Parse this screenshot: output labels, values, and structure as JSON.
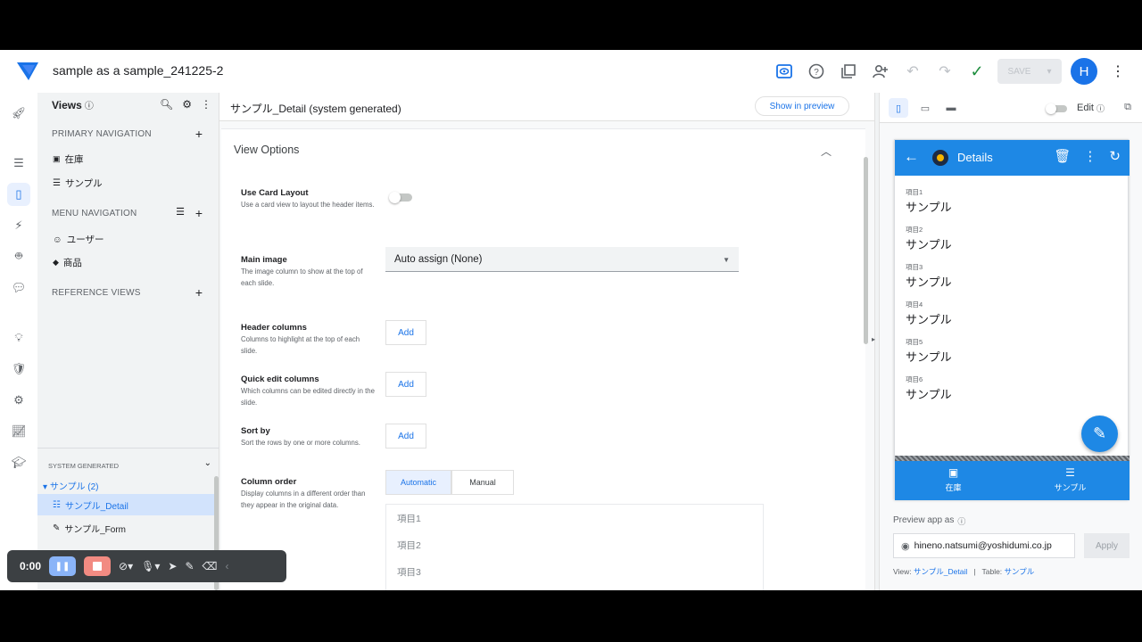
{
  "app": {
    "title": "sample as a sample_241225-2",
    "avatar_initial": "H",
    "save_label": "SAVE"
  },
  "views_panel": {
    "title": "Views",
    "primary_nav_label": "PRIMARY NAVIGATION",
    "primary_items": [
      "在庫",
      "サンプル"
    ],
    "menu_nav_label": "MENU NAVIGATION",
    "menu_items": [
      "ユーザー",
      "商品"
    ],
    "reference_label": "REFERENCE VIEWS",
    "system_label": "SYSTEM GENERATED",
    "system_group": "サンプル (2)",
    "system_items": [
      "サンプル_Detail",
      "サンプル_Form"
    ]
  },
  "editor": {
    "title": "サンプル_Detail (system generated)",
    "preview_button": "Show in preview",
    "section_title": "View Options",
    "options": [
      {
        "label": "Use Card Layout",
        "desc": "Use a card view to layout the header items."
      },
      {
        "label": "Main image",
        "desc": "The image column to show at the top of each slide."
      },
      {
        "label": "Header columns",
        "desc": "Columns to highlight at the top of each slide."
      },
      {
        "label": "Quick edit columns",
        "desc": "Which columns can be edited directly in the slide."
      },
      {
        "label": "Sort by",
        "desc": "Sort the rows by one or more columns."
      },
      {
        "label": "Column order",
        "desc": "Display columns in a different order than they appear in the original data."
      }
    ],
    "card_layout_enabled": false,
    "main_image_value": "Auto assign (None)",
    "add_label": "Add",
    "order_modes": [
      "Automatic",
      "Manual"
    ],
    "order_items": [
      "項目1",
      "項目2",
      "項目3"
    ]
  },
  "preview": {
    "edit_label": "Edit",
    "app_bar_title": "Details",
    "fields": [
      {
        "label": "項目1",
        "value": "サンプル"
      },
      {
        "label": "項目2",
        "value": "サンプル"
      },
      {
        "label": "項目3",
        "value": "サンプル"
      },
      {
        "label": "項目4",
        "value": "サンプル"
      },
      {
        "label": "項目5",
        "value": "サンプル"
      },
      {
        "label": "項目6",
        "value": "サンプル"
      }
    ],
    "nav": [
      "在庫",
      "サンプル"
    ],
    "preview_as_label": "Preview app as",
    "preview_as_value": "hineno.natsumi@yoshidumi.co.jp",
    "apply_label": "Apply",
    "footer": {
      "view_label": "View:",
      "view_value": "サンプル_Detail",
      "sep": "|",
      "table_label": "Table:",
      "table_value": "サンプル"
    }
  },
  "recorder": {
    "time": "0:00"
  },
  "colors": {
    "accent": "#1a73e8",
    "phone_bar": "#1e88e5",
    "confirm": "#1e8e3e"
  }
}
